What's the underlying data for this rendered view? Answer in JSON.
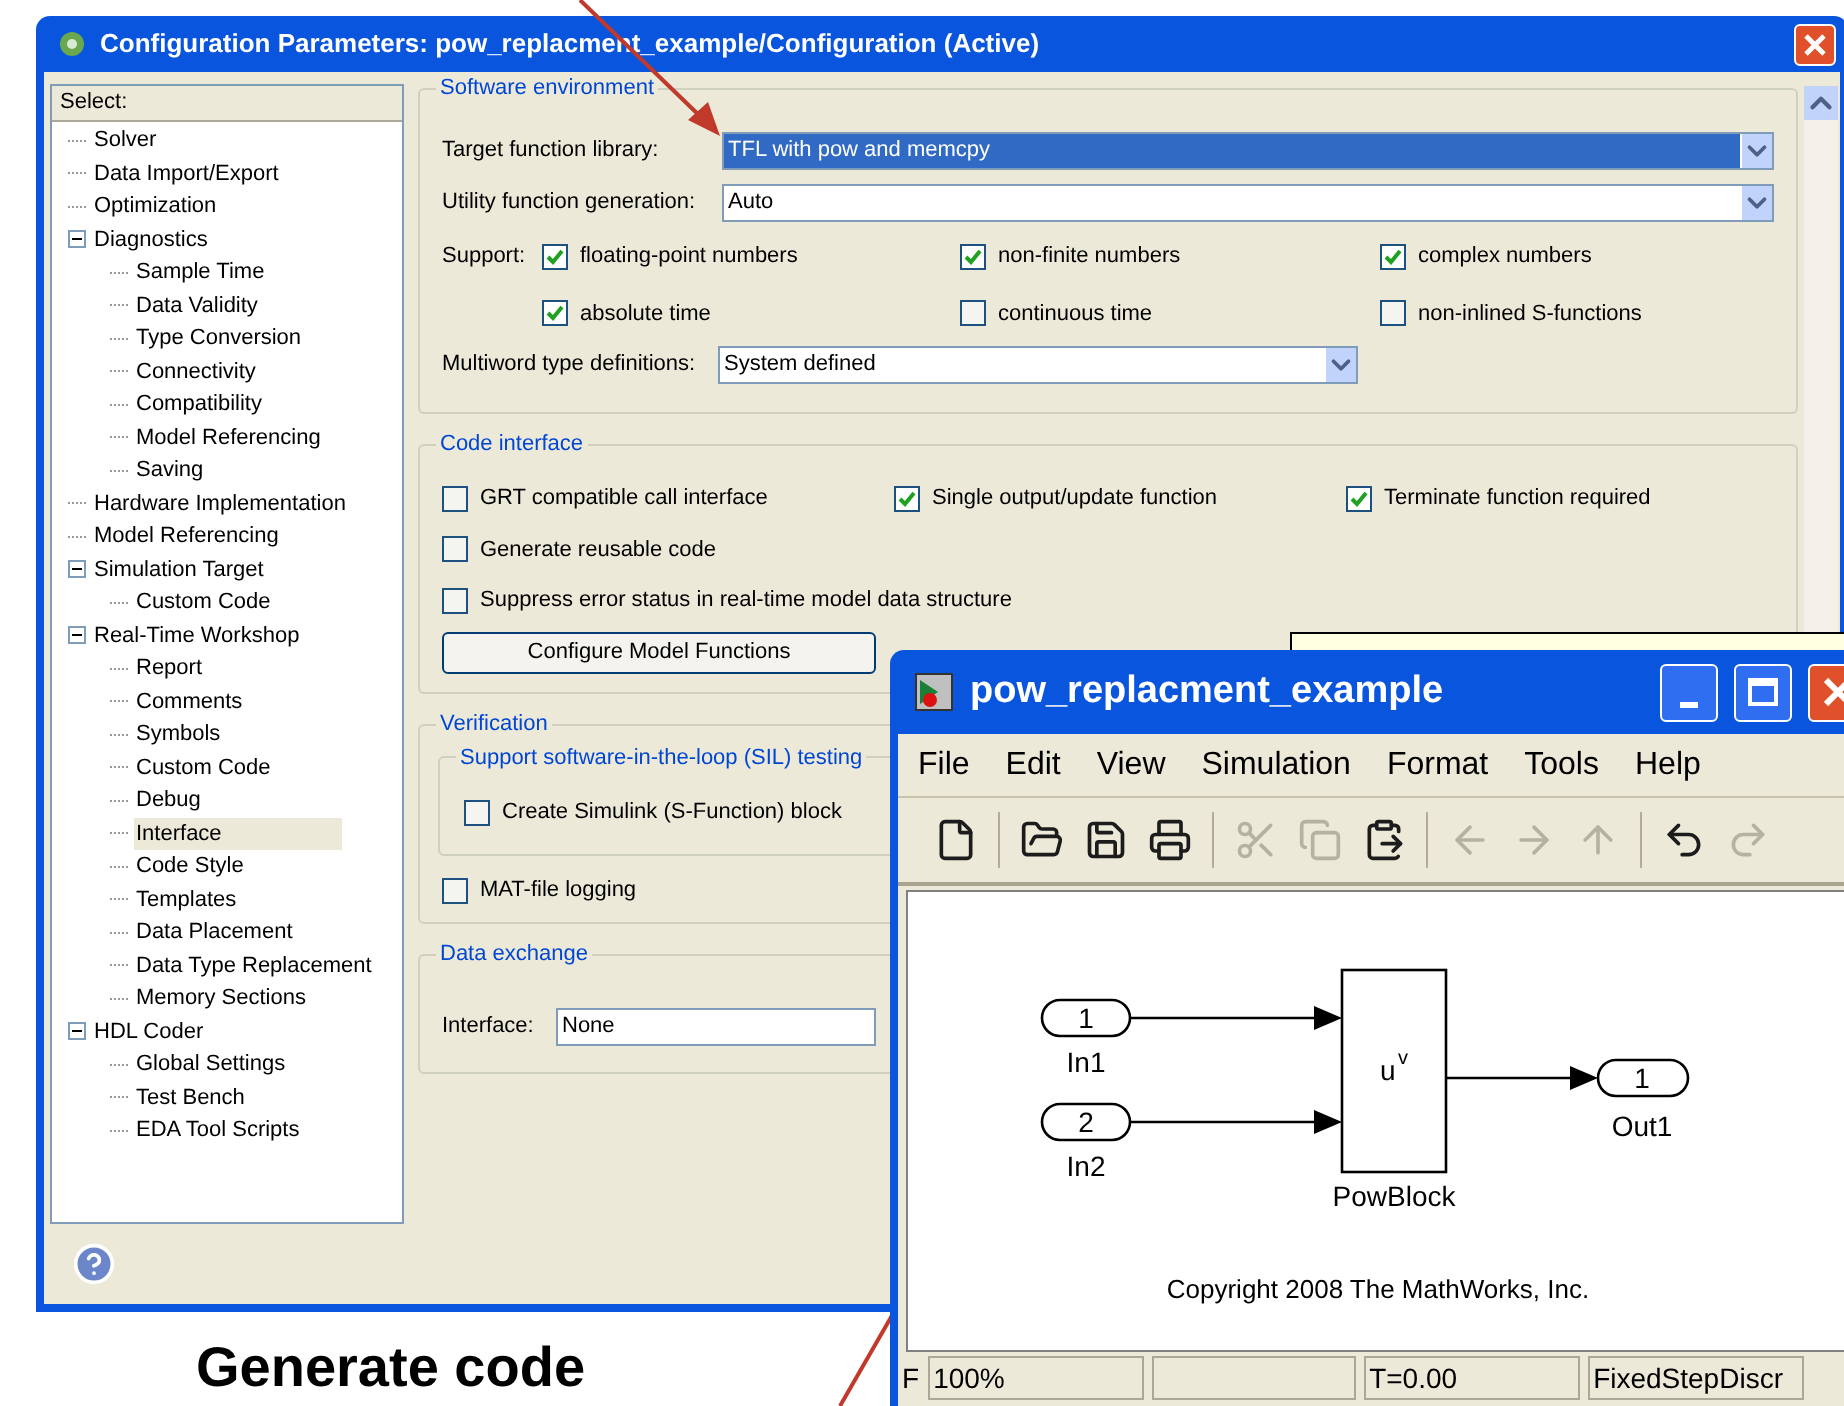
{
  "dialog": {
    "title": "Configuration Parameters: pow_replacment_example/Configuration (Active)",
    "tree": {
      "header": "Select:",
      "items": [
        {
          "label": "Solver",
          "selected": false
        },
        {
          "label": "Data Import/Export",
          "selected": false
        },
        {
          "label": "Optimization",
          "selected": false
        },
        {
          "label": "Diagnostics",
          "selected": false,
          "expanded": true,
          "children": [
            {
              "label": "Sample Time",
              "selected": false
            },
            {
              "label": "Data Validity",
              "selected": false
            },
            {
              "label": "Type Conversion",
              "selected": false
            },
            {
              "label": "Connectivity",
              "selected": false
            },
            {
              "label": "Compatibility",
              "selected": false
            },
            {
              "label": "Model Referencing",
              "selected": false
            },
            {
              "label": "Saving",
              "selected": false
            }
          ]
        },
        {
          "label": "Hardware Implementation",
          "selected": false
        },
        {
          "label": "Model Referencing",
          "selected": false
        },
        {
          "label": "Simulation Target",
          "selected": false,
          "expanded": true,
          "children": [
            {
              "label": "Custom Code",
              "selected": false
            }
          ]
        },
        {
          "label": "Real-Time Workshop",
          "selected": false,
          "expanded": true,
          "children": [
            {
              "label": "Report",
              "selected": false
            },
            {
              "label": "Comments",
              "selected": false
            },
            {
              "label": "Symbols",
              "selected": false
            },
            {
              "label": "Custom Code",
              "selected": false
            },
            {
              "label": "Debug",
              "selected": false
            },
            {
              "label": "Interface",
              "selected": true
            },
            {
              "label": "Code Style",
              "selected": false
            },
            {
              "label": "Templates",
              "selected": false
            },
            {
              "label": "Data Placement",
              "selected": false
            },
            {
              "label": "Data Type Replacement",
              "selected": false
            },
            {
              "label": "Memory Sections",
              "selected": false
            }
          ]
        },
        {
          "label": "HDL Coder",
          "selected": false,
          "expanded": true,
          "children": [
            {
              "label": "Global Settings",
              "selected": false
            },
            {
              "label": "Test Bench",
              "selected": false
            },
            {
              "label": "EDA Tool Scripts",
              "selected": false
            }
          ]
        }
      ]
    },
    "software_environment": {
      "title": "Software environment",
      "dropdowns": [
        {
          "label": "Target function library:",
          "value": "TFL with pow and memcpy",
          "selected": true
        },
        {
          "label": "Utility function generation:",
          "value": "Auto",
          "selected": false
        }
      ],
      "support": {
        "label": "Support:",
        "options": [
          {
            "label": "floating-point numbers",
            "checked": true
          },
          {
            "label": "non-finite numbers",
            "checked": true
          },
          {
            "label": "complex numbers",
            "checked": true
          },
          {
            "label": "absolute time",
            "checked": true
          },
          {
            "label": "continuous time",
            "checked": false
          },
          {
            "label": "non-inlined S-functions",
            "checked": false
          }
        ]
      },
      "multiword": {
        "label": "Multiword type definitions:",
        "value": "System defined"
      }
    },
    "code_interface": {
      "title": "Code interface",
      "rows": [
        [
          {
            "label": "GRT compatible call interface",
            "checked": false
          },
          {
            "label": "Single output/update function",
            "checked": true
          },
          {
            "label": "Terminate function required",
            "checked": true
          }
        ],
        [
          {
            "label": "Generate reusable code",
            "checked": false
          }
        ],
        [
          {
            "label": "Suppress error status in real-time model data structure",
            "checked": false
          }
        ]
      ],
      "button": "Configure Model Functions"
    },
    "verification": {
      "title": "Verification",
      "sil_group": {
        "title": "Support software-in-the-loop (SIL) testing",
        "option": {
          "label": "Create Simulink (S-Function) block",
          "checked": false
        }
      },
      "option": {
        "label": "MAT-file logging",
        "checked": false
      }
    },
    "data_exchange": {
      "title": "Data exchange",
      "field": {
        "label": "Interface:",
        "value": "None"
      }
    }
  },
  "model_window": {
    "title": "pow_replacment_example",
    "menu": [
      "File",
      "Edit",
      "View",
      "Simulation",
      "Format",
      "Tools",
      "Help"
    ],
    "toolbar": [
      {
        "kind": "new",
        "disabled": false
      },
      {
        "kind": "separator"
      },
      {
        "kind": "open",
        "disabled": false
      },
      {
        "kind": "save",
        "disabled": false
      },
      {
        "kind": "print",
        "disabled": false
      },
      {
        "kind": "separator"
      },
      {
        "kind": "cut",
        "disabled": true
      },
      {
        "kind": "copy",
        "disabled": true
      },
      {
        "kind": "paste",
        "disabled": false
      },
      {
        "kind": "separator"
      },
      {
        "kind": "back",
        "disabled": true
      },
      {
        "kind": "forward",
        "disabled": true
      },
      {
        "kind": "up",
        "disabled": true
      },
      {
        "kind": "separator"
      },
      {
        "kind": "undo",
        "disabled": false
      },
      {
        "kind": "redo",
        "disabled": true
      }
    ],
    "diagram": {
      "inports": [
        {
          "number": "1",
          "label": "In1"
        },
        {
          "number": "2",
          "label": "In2"
        }
      ],
      "block": {
        "operand": "u",
        "exponent": "v",
        "label": "PowBlock"
      },
      "outport": {
        "number": "1",
        "label": "Out1"
      },
      "copyright": "Copyright 2008 The MathWorks, Inc."
    },
    "status_bar": [
      {
        "kind": "label",
        "text": "F"
      },
      {
        "kind": "cell",
        "text": "100%"
      },
      {
        "kind": "empty"
      },
      {
        "kind": "cell",
        "text": "T=0.00"
      },
      {
        "kind": "cell",
        "text": "FixedStepDiscr"
      }
    ]
  },
  "annotation": {
    "caption": "Generate code"
  }
}
